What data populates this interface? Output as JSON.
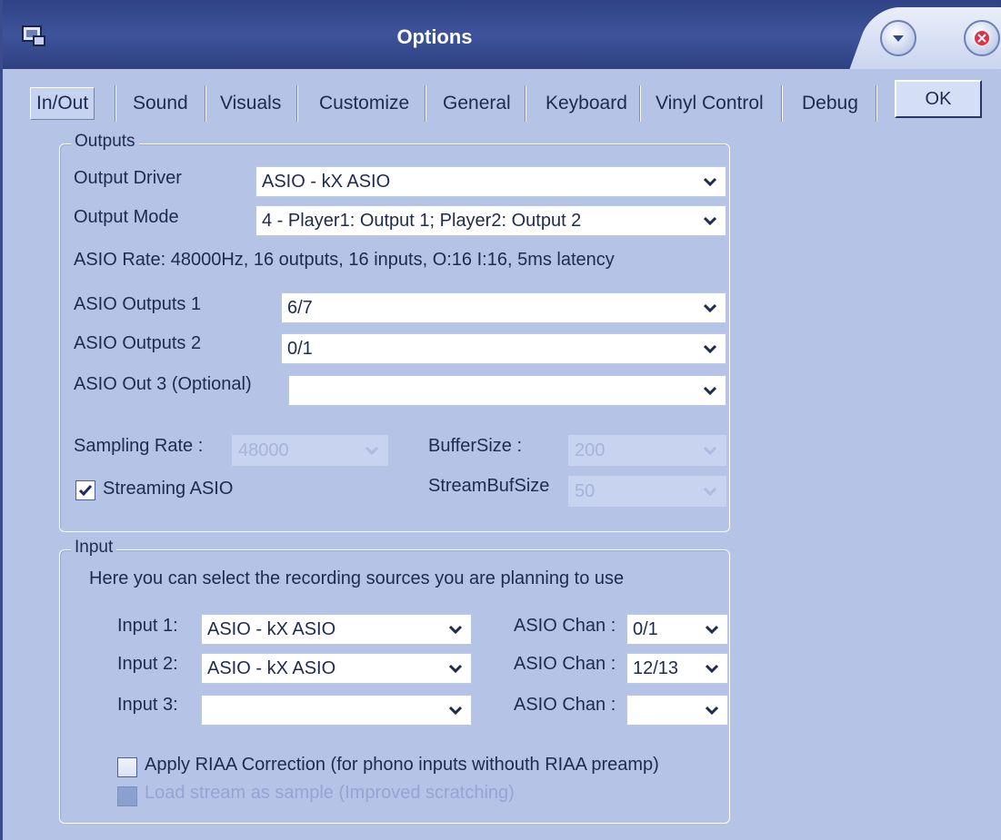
{
  "window": {
    "title": "Options",
    "colors": {
      "background": "#b4c3e6",
      "titlebar": "#34478a",
      "text": "#1f2a4f"
    }
  },
  "tabs": [
    {
      "label": "In/Out",
      "active": true
    },
    {
      "label": "Sound",
      "active": false
    },
    {
      "label": "Visuals",
      "active": false
    },
    {
      "label": "Customize",
      "active": false
    },
    {
      "label": "General",
      "active": false
    },
    {
      "label": "Keyboard",
      "active": false
    },
    {
      "label": "Vinyl Control",
      "active": false
    },
    {
      "label": "Debug",
      "active": false
    }
  ],
  "ok_label": "OK",
  "outputs": {
    "group_title": "Outputs",
    "output_driver_label": "Output Driver",
    "output_driver_value": "ASIO - kX ASIO",
    "output_mode_label": "Output Mode",
    "output_mode_value": "4 - Player1: Output 1; Player2: Output 2",
    "asio_rate_info": "ASIO Rate: 48000Hz, 16 outputs, 16 inputs, O:16 I:16, 5ms latency",
    "asio_outputs_1_label": "ASIO Outputs 1",
    "asio_outputs_1_value": "6/7",
    "asio_outputs_2_label": "ASIO Outputs 2",
    "asio_outputs_2_value": "0/1",
    "asio_out_3_label": "ASIO Out 3 (Optional)",
    "asio_out_3_value": "",
    "sampling_rate_label": "Sampling Rate :",
    "sampling_rate_value": "48000",
    "buffer_size_label": "BufferSize :",
    "buffer_size_value": "200",
    "streaming_asio_label": "Streaming ASIO",
    "streaming_asio_checked": true,
    "stream_buf_size_label": "StreamBufSize",
    "stream_buf_size_value": "50"
  },
  "input": {
    "group_title": "Input",
    "description": "Here you can select the recording sources you are planning to use",
    "rows": [
      {
        "label": "Input 1:",
        "device": "ASIO - kX ASIO",
        "chan_label": "ASIO Chan :",
        "chan": "0/1"
      },
      {
        "label": "Input 2:",
        "device": "ASIO - kX ASIO",
        "chan_label": "ASIO Chan :",
        "chan": "12/13"
      },
      {
        "label": "Input 3:",
        "device": "",
        "chan_label": "ASIO Chan :",
        "chan": ""
      }
    ],
    "riaa_label": "Apply RIAA Correction (for phono inputs withouth RIAA preamp)",
    "riaa_checked": false,
    "load_stream_label": "Load stream as sample (Improved scratching)",
    "load_stream_enabled": false
  },
  "icons": {
    "app": "app-icon",
    "minimize": "chevron-down-icon",
    "close": "close-icon",
    "dropdown": "chevron-down-icon",
    "check": "checkmark-icon"
  }
}
